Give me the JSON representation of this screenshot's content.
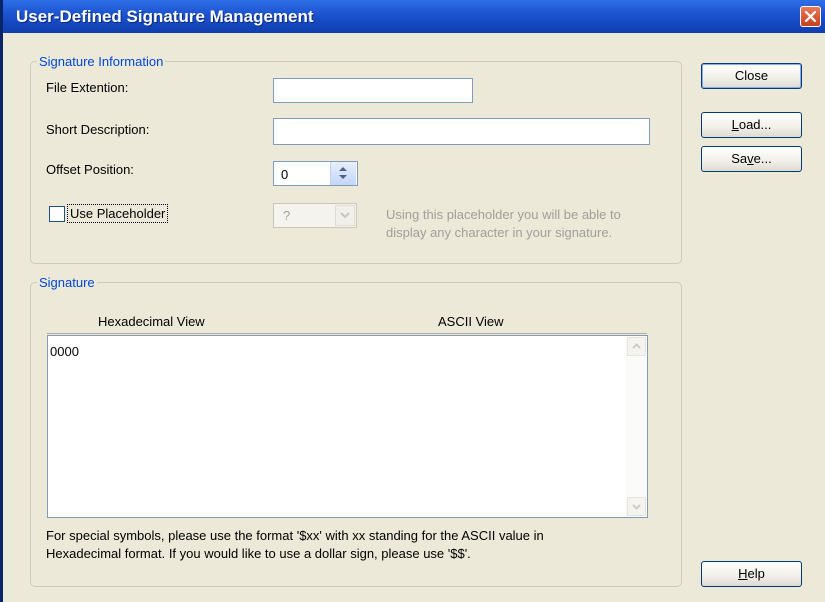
{
  "window": {
    "title": "User-Defined Signature Management"
  },
  "signature_info": {
    "legend": "Signature Information",
    "file_extension_label": "File Extention:",
    "file_extension_value": "",
    "short_description_label": "Short Description:",
    "short_description_value": "",
    "offset_label": "Offset Position:",
    "offset_value": "0",
    "use_placeholder_label": "Use Placeholder",
    "use_placeholder_checked": false,
    "placeholder_value": "?",
    "placeholder_hint_line1": "Using this placeholder you will be able to",
    "placeholder_hint_line2": "display any character in your signature."
  },
  "signature": {
    "legend": "Signature",
    "col_hex": "Hexadecimal View",
    "col_ascii": "ASCII View",
    "content": "0000",
    "note_line1": "For special symbols, please use the format '$xx' with xx standing for the ASCII value in",
    "note_line2": "Hexadecimal format. If you would like to use a dollar sign, please use '$$'."
  },
  "buttons": {
    "close": "Close",
    "load_u": "L",
    "load_rest": "oad...",
    "save_pre": "Sa",
    "save_u": "v",
    "save_rest": "e...",
    "help_u": "H",
    "help_rest": "elp"
  },
  "colors": {
    "titlebar": "#1d55d0",
    "legend": "#0046d5",
    "face": "#ece9d8"
  }
}
